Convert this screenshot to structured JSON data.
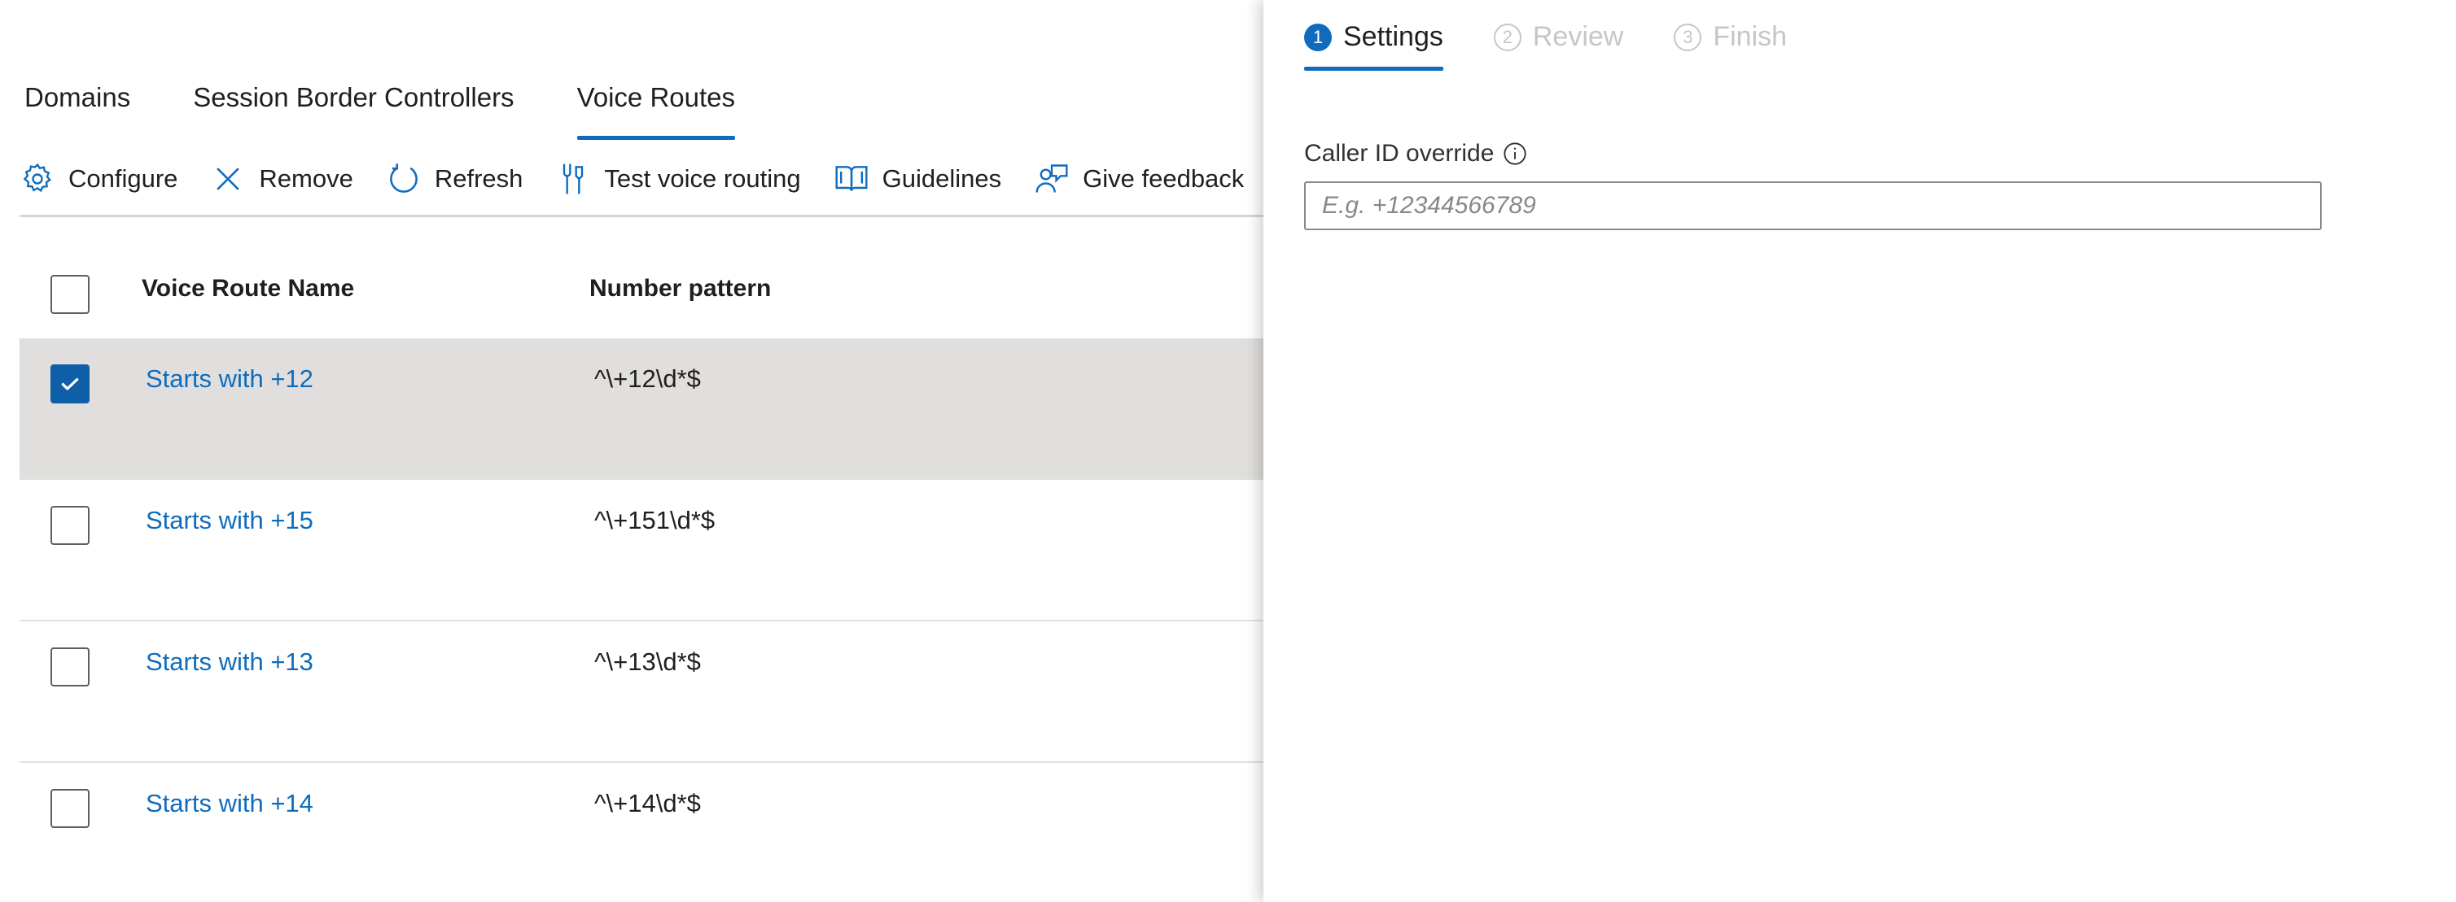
{
  "tabs": [
    {
      "label": "Domains",
      "active": false
    },
    {
      "label": "Session Border Controllers",
      "active": false
    },
    {
      "label": "Voice Routes",
      "active": true
    }
  ],
  "toolbar": {
    "configure": "Configure",
    "remove": "Remove",
    "refresh": "Refresh",
    "test_voice_routing": "Test voice routing",
    "guidelines": "Guidelines",
    "give_feedback": "Give feedback"
  },
  "table": {
    "columns": [
      "Voice Route Name",
      "Number pattern"
    ],
    "rows": [
      {
        "name": "Starts with +12",
        "pattern": "^\\+12\\d*$",
        "selected": true
      },
      {
        "name": "Starts with +15",
        "pattern": "^\\+151\\d*$",
        "selected": false
      },
      {
        "name": "Starts with +13",
        "pattern": "^\\+13\\d*$",
        "selected": false
      },
      {
        "name": "Starts with +14",
        "pattern": "^\\+14\\d*$",
        "selected": false
      }
    ]
  },
  "wizard": {
    "steps": [
      {
        "number": "1",
        "label": "Settings",
        "active": true
      },
      {
        "number": "2",
        "label": "Review",
        "active": false
      },
      {
        "number": "3",
        "label": "Finish",
        "active": false
      }
    ],
    "caller_id": {
      "label": "Caller ID override",
      "placeholder": "E.g. +12344566789",
      "value": ""
    }
  },
  "colors": {
    "accent": "#0f6cbd",
    "selected_row": "#e1dfdd",
    "checkbox_checked": "#0f5ea8"
  },
  "icons": {
    "configure": "gear-icon",
    "remove": "close-icon",
    "refresh": "refresh-icon",
    "test_voice_routing": "tools-icon",
    "guidelines": "book-icon",
    "give_feedback": "feedback-icon",
    "field_info": "info-icon",
    "checkbox_check": "checkmark-icon"
  }
}
